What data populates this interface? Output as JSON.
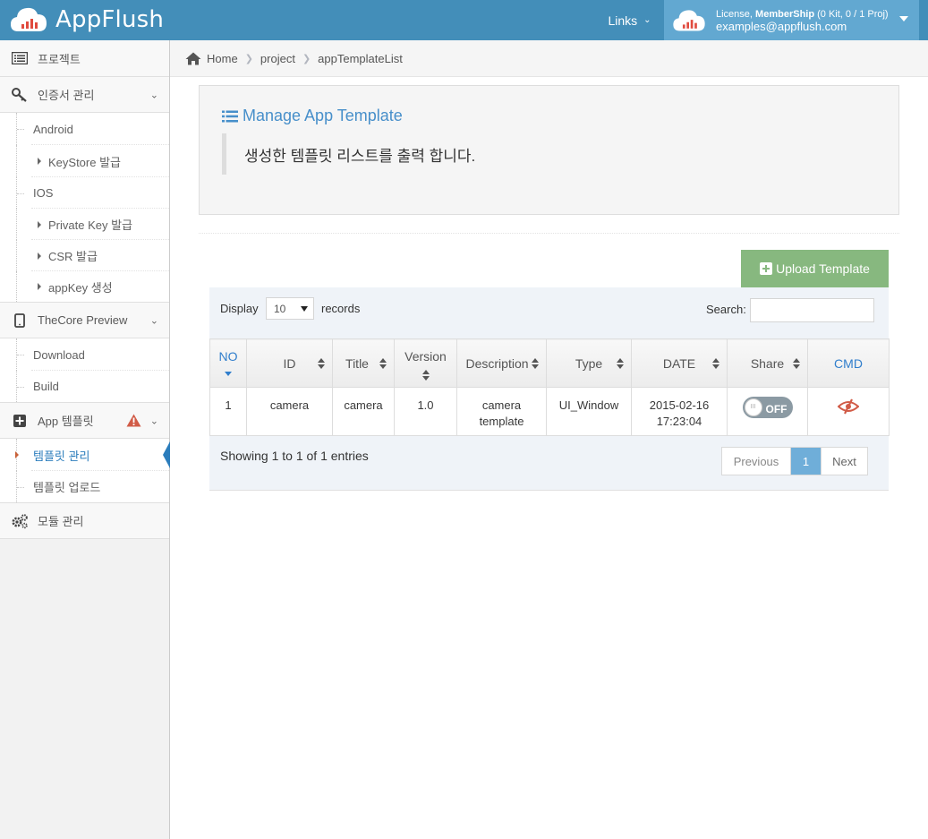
{
  "app": {
    "title": "AppFlush"
  },
  "header": {
    "links_label": "Links",
    "license_prefix": "License,",
    "license_plan": "MemberShip",
    "license_usage": "(0 Kit, 0 / 1 Proj)",
    "user_email": "examples@appflush.com"
  },
  "sidebar": {
    "project": "프로젝트",
    "certificates": "인증서 관리",
    "android": "Android",
    "keystore": "KeyStore 발급",
    "ios": "IOS",
    "private_key": "Private Key 발급",
    "csr": "CSR 발급",
    "appkey": "appKey 생성",
    "thecore_preview": "TheCore Preview",
    "download": "Download",
    "build": "Build",
    "app_template": "App 템플릿",
    "template_manage": "템플릿 관리",
    "template_upload": "템플릿 업로드",
    "module_manage": "모듈 관리"
  },
  "breadcrumb": {
    "home": "Home",
    "project": "project",
    "current": "appTemplateList"
  },
  "page": {
    "title": "Manage App Template",
    "description": "생성한 템플릿 리스트를 출력 합니다.",
    "upload_button": "Upload Template"
  },
  "table": {
    "display_label": "Display",
    "display_value": "10",
    "records_label": "records",
    "search_label": "Search:",
    "columns": [
      "NO",
      "ID",
      "Title",
      "Version",
      "Description",
      "Type",
      "DATE",
      "Share",
      "CMD"
    ],
    "rows": [
      {
        "no": "1",
        "id": "camera",
        "title": "camera",
        "version": "1.0",
        "description": "camera template",
        "type": "UI_Window",
        "date": "2015-02-16 17:23:04",
        "share": "OFF"
      }
    ],
    "showing": "Showing 1 to 1 of 1 entries",
    "pager": {
      "previous": "Previous",
      "page": "1",
      "next": "Next"
    }
  },
  "colors": {
    "header": "#438eb9",
    "user_box": "#62a8d1",
    "accent": "#478fca",
    "upload": "#87b87f",
    "warning": "#d15b47"
  }
}
